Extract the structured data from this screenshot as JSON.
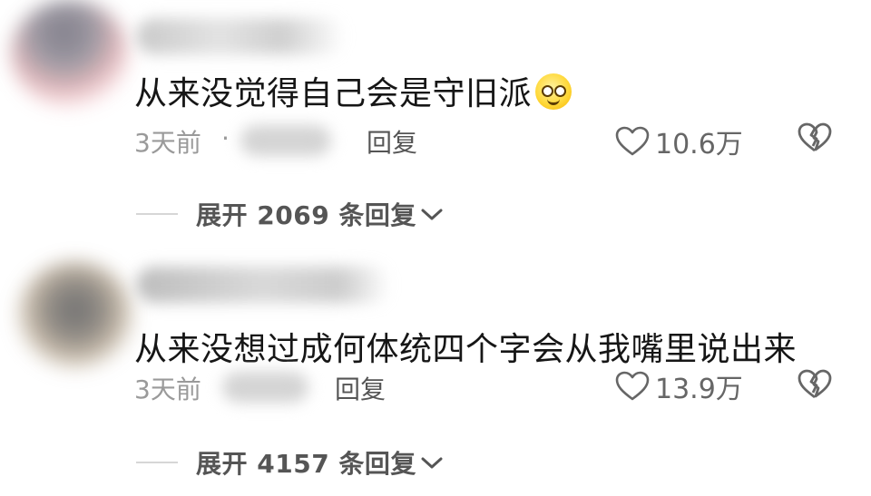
{
  "comments": [
    {
      "text": "从来没觉得自己会是守旧派",
      "emoji": "smiling-face-emoji",
      "time": "3天前",
      "separator": "·",
      "reply_label": "回复",
      "like_count": "10.6万",
      "expand_label": "展开 2069 条回复"
    },
    {
      "text": "从来没想过成何体统四个字会从我嘴里说出来",
      "time": "3天前",
      "reply_label": "回复",
      "like_count": "13.9万",
      "expand_label": "展开 4157 条回复"
    }
  ],
  "icons": {
    "like": "heart-outline-icon",
    "dislike": "broken-heart-icon",
    "expand": "chevron-down-icon"
  },
  "colors": {
    "text": "#161616",
    "meta": "#9a9a9a",
    "action": "#555555"
  }
}
